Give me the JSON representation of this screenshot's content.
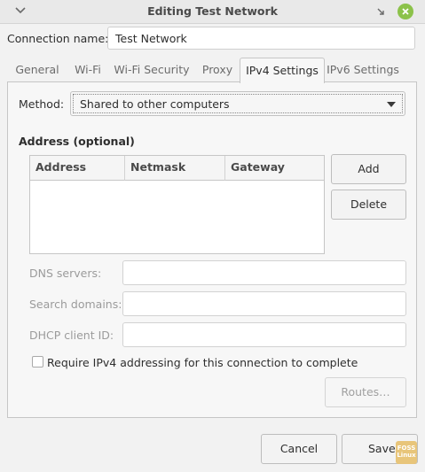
{
  "window": {
    "title": "Editing Test Network"
  },
  "connection": {
    "label": "Connection name:",
    "value": "Test Network"
  },
  "tabs": [
    {
      "label": "General"
    },
    {
      "label": "Wi-Fi"
    },
    {
      "label": "Wi-Fi Security"
    },
    {
      "label": "Proxy"
    },
    {
      "label": "IPv4 Settings",
      "active": true
    },
    {
      "label": "IPv6 Settings"
    }
  ],
  "method": {
    "label": "Method:",
    "value": "Shared to other computers"
  },
  "address": {
    "heading": "Address (optional)",
    "columns": [
      "Address",
      "Netmask",
      "Gateway"
    ],
    "rows": []
  },
  "buttons": {
    "add": "Add",
    "delete": "Delete",
    "routes": "Routes…",
    "cancel": "Cancel",
    "save": "Save"
  },
  "fields": {
    "dns_label": "DNS servers:",
    "search_label": "Search domains:",
    "dhcp_label": "DHCP client ID:"
  },
  "require_ipv4": {
    "label": "Require IPv4 addressing for this connection to complete",
    "checked": false
  },
  "watermark": {
    "line1": "FOSS",
    "line2": "Linux"
  },
  "colors": {
    "close_button": "#8cc24a",
    "watermark": "#e8c57a"
  }
}
